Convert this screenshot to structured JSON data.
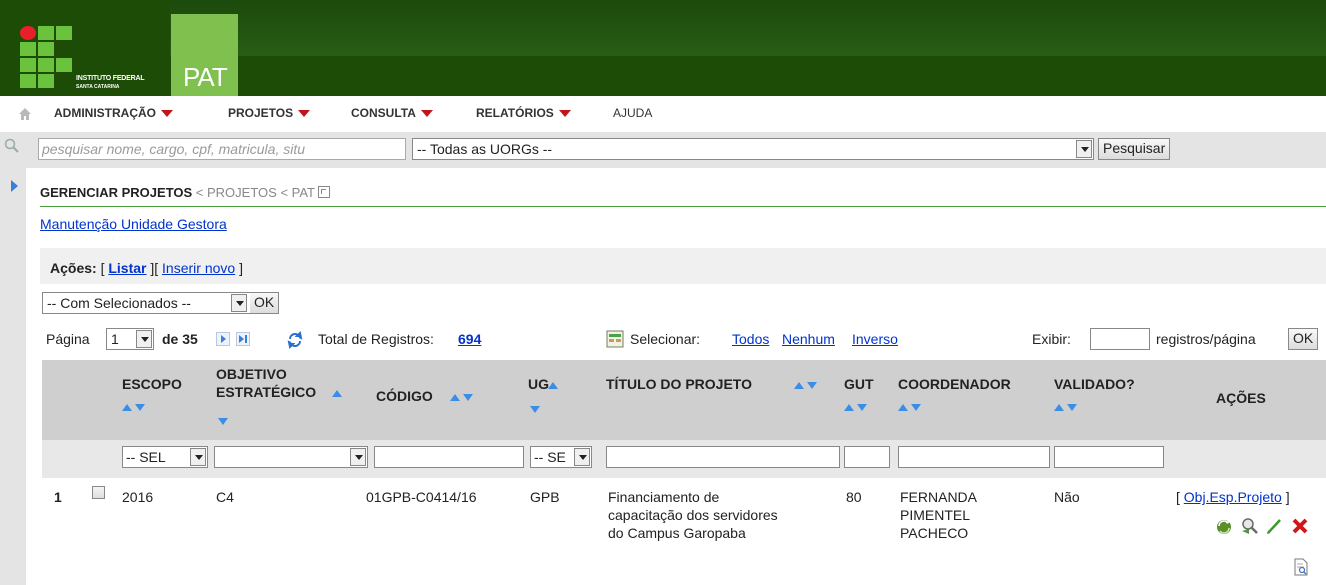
{
  "header": {
    "org_line1": "INSTITUTO FEDERAL",
    "org_line2": "SANTA CATARINA",
    "app_name": "PAT"
  },
  "menu": {
    "items": [
      {
        "label": "ADMINISTRAÇÃO",
        "has_arrow": true
      },
      {
        "label": "PROJETOS",
        "has_arrow": true
      },
      {
        "label": "CONSULTA",
        "has_arrow": true
      },
      {
        "label": "RELATÓRIOS",
        "has_arrow": true
      },
      {
        "label": "AJUDA",
        "has_arrow": false
      }
    ]
  },
  "search": {
    "placeholder": "pesquisar nome, cargo, cpf, matricula, situ",
    "uorg_selected": "-- Todas as UORGs --",
    "button_label": "Pesquisar"
  },
  "breadcrumb": {
    "current": "GERENCIAR PROJETOS",
    "rest": " < PROJETOS < PAT"
  },
  "links": {
    "manutencao": "Manutenção Unidade Gestora"
  },
  "acoes": {
    "label": "Ações:",
    "open1": "[",
    "listar": "Listar",
    "mid": "][",
    "inserir": "Inserir novo",
    "close": "]"
  },
  "bulk": {
    "selected": "-- Com Selecionados --",
    "ok_label": "OK"
  },
  "pagination": {
    "pagina_label": "Página",
    "current_page": "1",
    "de_label": "de 35",
    "total_label": "Total de Registros:",
    "total": "694",
    "selecionar_label": "Selecionar:",
    "todos": "Todos",
    "nenhum": "Nenhum",
    "inverso": "Inverso",
    "exibir_label": "Exibir:",
    "registros_label": "registros/página",
    "ok_label": "OK"
  },
  "table": {
    "headers": {
      "escopo": "ESCOPO",
      "objetivo_1": "OBJETIVO",
      "objetivo_2": "ESTRATÉGICO",
      "codigo": "CÓDIGO",
      "ug": "UG",
      "titulo": "TÍTULO DO PROJETO",
      "gut": "GUT",
      "coordenador": "COORDENADOR",
      "validado": "VALIDADO?",
      "acoes": "AÇÕES"
    },
    "filters": {
      "escopo": "-- SEL",
      "ug": "-- SE"
    },
    "rows": [
      {
        "index": "1",
        "escopo": "2016",
        "objetivo": "C4",
        "codigo": "01GPB-C0414/16",
        "ug": "GPB",
        "titulo_1": "Financiamento de",
        "titulo_2": "capacitação dos servidores",
        "titulo_3": "do Campus Garopaba",
        "gut": "80",
        "coord_1": "FERNANDA",
        "coord_2": "PIMENTEL",
        "coord_3": "PACHECO",
        "validado": "Não",
        "acao_open": "[",
        "acao_link": "Obj.Esp.Projeto",
        "acao_close": "]"
      }
    ]
  },
  "colors": {
    "header_green": "#1d4c07",
    "pat_green": "#7fc04e",
    "link_blue": "#0033cc",
    "sort_blue": "#3a8ee8",
    "menu_arrow_red": "#c0151b"
  }
}
